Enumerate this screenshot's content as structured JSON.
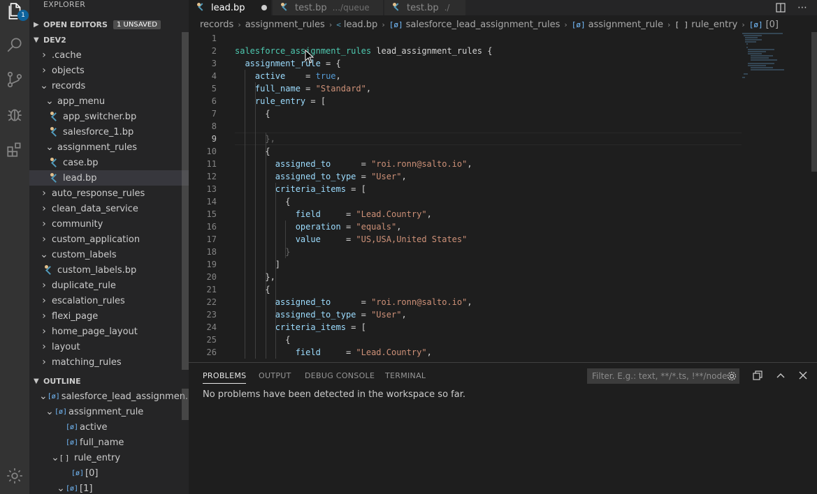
{
  "activity_bar": {
    "explorer_badge": "1",
    "icons": [
      "files-icon",
      "search-icon",
      "source-control-icon",
      "debug-icon",
      "extensions-icon",
      "gear-icon"
    ]
  },
  "sidebar": {
    "title": "EXPLORER",
    "open_editors": {
      "label": "OPEN EDITORS",
      "tag": "1 UNSAVED"
    },
    "workspace": {
      "label": "DEV2"
    },
    "tree": [
      {
        "label": ".cache",
        "twist": "›"
      },
      {
        "label": "objects",
        "twist": "›"
      },
      {
        "label": "records",
        "twist": "⌄"
      },
      {
        "label": "app_menu",
        "twist": "⌄"
      },
      {
        "label": "app_switcher.bp",
        "file": true
      },
      {
        "label": "salesforce_1.bp",
        "file": true
      },
      {
        "label": "assignment_rules",
        "twist": "⌄"
      },
      {
        "label": "case.bp",
        "file": true
      },
      {
        "label": "lead.bp",
        "file": true,
        "selected": true
      },
      {
        "label": "auto_response_rules",
        "twist": "›"
      },
      {
        "label": "clean_data_service",
        "twist": "›"
      },
      {
        "label": "community",
        "twist": "›"
      },
      {
        "label": "custom_application",
        "twist": "›"
      },
      {
        "label": "custom_labels",
        "twist": "⌄"
      },
      {
        "label": "custom_labels.bp",
        "file": true
      },
      {
        "label": "duplicate_rule",
        "twist": "›"
      },
      {
        "label": "escalation_rules",
        "twist": "›"
      },
      {
        "label": "flexi_page",
        "twist": "›"
      },
      {
        "label": "home_page_layout",
        "twist": "›"
      },
      {
        "label": "layout",
        "twist": "›"
      },
      {
        "label": "matching_rules",
        "twist": "›"
      }
    ],
    "outline": {
      "label": "OUTLINE",
      "items": [
        {
          "label": "salesforce_lead_assignmen...",
          "sym": "[ø]"
        },
        {
          "label": "assignment_rule",
          "sym": "[ø]"
        },
        {
          "label": "active",
          "sym": "[ø]"
        },
        {
          "label": "full_name",
          "sym": "[ø]"
        },
        {
          "label": "rule_entry",
          "sym": "[ ]"
        },
        {
          "label": "[0]",
          "sym": "[ø]"
        },
        {
          "label": "[1]",
          "sym": "[ø]"
        }
      ]
    }
  },
  "tabs": [
    {
      "label": "lead.bp",
      "desc": "",
      "active": true,
      "modified": true
    },
    {
      "label": "test.bp",
      "desc": ".../queue",
      "active": false
    },
    {
      "label": "test.bp",
      "desc": "./",
      "active": false
    }
  ],
  "breadcrumb": [
    "records",
    "assignment_rules",
    "lead.bp",
    "salesforce_lead_assignment_rules",
    "assignment_rule",
    "rule_entry",
    "[0]"
  ],
  "editor": {
    "current_line": 9,
    "lines": [
      {
        "n": "1",
        "text": ""
      },
      {
        "n": "2",
        "text": "salesforce_assignment_rules lead_assignment_rules {"
      },
      {
        "n": "3",
        "text": "  assignment_rule = {"
      },
      {
        "n": "4",
        "text": "    active    = true,"
      },
      {
        "n": "5",
        "text": "    full_name = \"Standard\","
      },
      {
        "n": "6",
        "text": "    rule_entry = ["
      },
      {
        "n": "7",
        "text": "      {"
      },
      {
        "n": "8",
        "text": ""
      },
      {
        "n": "9",
        "text": "      },"
      },
      {
        "n": "10",
        "text": "      {"
      },
      {
        "n": "11",
        "text": "        assigned_to      = \"roi.ronn@salto.io\","
      },
      {
        "n": "12",
        "text": "        assigned_to_type = \"User\","
      },
      {
        "n": "13",
        "text": "        criteria_items = ["
      },
      {
        "n": "14",
        "text": "          {"
      },
      {
        "n": "15",
        "text": "            field     = \"Lead.Country\","
      },
      {
        "n": "16",
        "text": "            operation = \"equals\","
      },
      {
        "n": "17",
        "text": "            value     = \"US,USA,United States\""
      },
      {
        "n": "18",
        "text": "          }"
      },
      {
        "n": "19",
        "text": "        ]"
      },
      {
        "n": "20",
        "text": "      },"
      },
      {
        "n": "21",
        "text": "      {"
      },
      {
        "n": "22",
        "text": "        assigned_to      = \"roi.ronn@salto.io\","
      },
      {
        "n": "23",
        "text": "        assigned_to_type = \"User\","
      },
      {
        "n": "24",
        "text": "        criteria_items = ["
      },
      {
        "n": "25",
        "text": "          {"
      },
      {
        "n": "26",
        "text": "            field     = \"Lead.Country\","
      }
    ]
  },
  "panel": {
    "tabs": [
      "PROBLEMS",
      "OUTPUT",
      "DEBUG CONSOLE",
      "TERMINAL"
    ],
    "active_tab": "PROBLEMS",
    "filter_placeholder": "Filter. E.g.: text, **/*.ts, !**/node...",
    "message": "No problems have been detected in the workspace so far."
  },
  "colors": {
    "accent": "#0e639c",
    "keyword": "#9cdcfe",
    "string": "#ce9178",
    "boolean": "#569cd6",
    "modified_dot": "#e2c08d"
  }
}
